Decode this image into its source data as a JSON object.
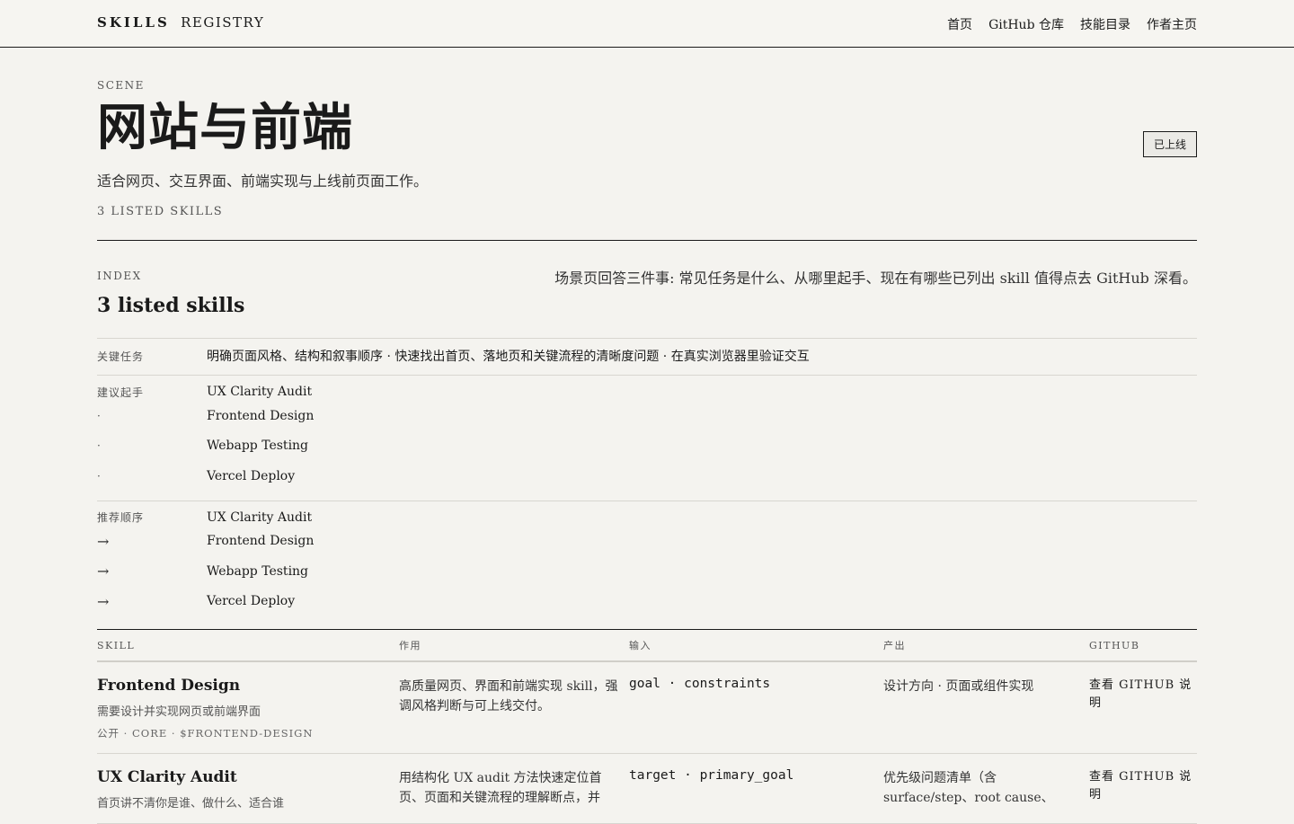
{
  "nav": {
    "brand_primary": "SKILLS",
    "brand_secondary": "REGISTRY",
    "links": [
      "首页",
      "GitHub 仓库",
      "技能目录",
      "作者主页"
    ]
  },
  "hero": {
    "eyebrow": "SCENE",
    "title": "网站与前端",
    "subtitle": "适合网页、交互界面、前端实现与上线前页面工作。",
    "count": "3 LISTED SKILLS",
    "status": "已上线"
  },
  "index": {
    "eyebrow": "INDEX",
    "title": "3 listed skills",
    "note": "场景页回答三件事: 常见任务是什么、从哪里起手、现在有哪些已列出 skill 值得点去 GitHub 深看。"
  },
  "meta": {
    "tasks_label": "关键任务",
    "tasks_value": "明确页面风格、结构和叙事顺序 · 快速找出首页、落地页和关键流程的清晰度问题 · 在真实浏览器里验证交互",
    "start_label": "建议起手",
    "start_bullet": "·",
    "start_items": [
      "UX Clarity Audit",
      "Frontend Design",
      "Webapp Testing",
      "Vercel Deploy"
    ],
    "order_label": "推荐顺序",
    "order_arrow": "→",
    "order_items": [
      "UX Clarity Audit",
      "Frontend Design",
      "Webapp Testing",
      "Vercel Deploy"
    ]
  },
  "table": {
    "headers": [
      "SKILL",
      "作用",
      "输入",
      "产出",
      "GITHUB"
    ],
    "rows": [
      {
        "name": "Frontend Design",
        "desc": "需要设计并实现网页或前端界面",
        "tags": "公开 · CORE · $FRONTEND-DESIGN",
        "purpose": "高质量网页、界面和前端实现 skill，强调风格判断与可上线交付。",
        "input": "goal · constraints",
        "output": "设计方向 · 页面或组件实现",
        "link": "查看 GITHUB 说明"
      },
      {
        "name": "UX Clarity Audit",
        "desc": "首页讲不清你是谁、做什么、适合谁",
        "tags": "",
        "purpose": "用结构化 UX audit 方法快速定位首页、页面和关键流程的理解断点，并",
        "input": "target · primary_goal",
        "output": "优先级问题清单（含 surface/step、root cause、",
        "link": "查看 GITHUB 说明"
      }
    ]
  }
}
